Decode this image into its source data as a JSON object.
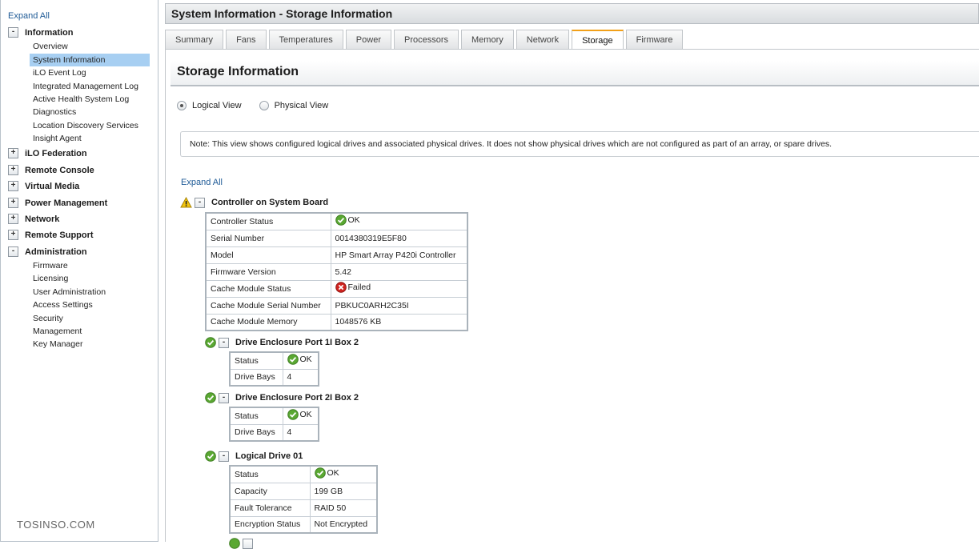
{
  "sidebar": {
    "expand_all": "Expand All",
    "information": {
      "label": "Information",
      "toggle": "-",
      "items": [
        "Overview",
        "System Information",
        "iLO Event Log",
        "Integrated Management Log",
        "Active Health System Log",
        "Diagnostics",
        "Location Discovery Services",
        "Insight Agent"
      ]
    },
    "collapsed": [
      {
        "label": "iLO Federation",
        "toggle": "+"
      },
      {
        "label": "Remote Console",
        "toggle": "+"
      },
      {
        "label": "Virtual Media",
        "toggle": "+"
      },
      {
        "label": "Power Management",
        "toggle": "+"
      },
      {
        "label": "Network",
        "toggle": "+"
      },
      {
        "label": "Remote Support",
        "toggle": "+"
      }
    ],
    "administration": {
      "label": "Administration",
      "toggle": "-",
      "items": [
        "Firmware",
        "Licensing",
        "User Administration",
        "Access Settings",
        "Security",
        "Management",
        "Key Manager"
      ]
    },
    "active_item": "System Information"
  },
  "watermark": "TOSINSO.COM",
  "header": {
    "title": "System Information - Storage Information"
  },
  "tabs": [
    "Summary",
    "Fans",
    "Temperatures",
    "Power",
    "Processors",
    "Memory",
    "Network",
    "Storage",
    "Firmware"
  ],
  "active_tab": "Storage",
  "content": {
    "heading": "Storage Information",
    "view_options": [
      "Logical View",
      "Physical View"
    ],
    "selected_view": "Logical View",
    "note": "Note: This view shows configured logical drives and associated physical drives. It does not show physical drives which are not configured as part of an array, or spare drives.",
    "expand_all": "Expand All",
    "controller": {
      "title": "Controller on System Board",
      "toggle": "-",
      "rows": [
        {
          "label": "Controller Status",
          "value": "OK",
          "icon": "ok-icon"
        },
        {
          "label": "Serial Number",
          "value": "0014380319E5F80"
        },
        {
          "label": "Model",
          "value": "HP Smart Array P420i Controller"
        },
        {
          "label": "Firmware Version",
          "value": "5.42"
        },
        {
          "label": "Cache Module Status",
          "value": "Failed",
          "icon": "failed-icon"
        },
        {
          "label": "Cache Module Serial Number",
          "value": "PBKUC0ARH2C35I"
        },
        {
          "label": "Cache Module Memory",
          "value": "1048576 KB"
        }
      ]
    },
    "enclosures": [
      {
        "title": "Drive Enclosure Port 1I Box 2",
        "toggle": "-",
        "rows": [
          {
            "label": "Status",
            "value": "OK",
            "icon": "ok-icon"
          },
          {
            "label": "Drive Bays",
            "value": "4"
          }
        ]
      },
      {
        "title": "Drive Enclosure Port 2I Box 2",
        "toggle": "-",
        "rows": [
          {
            "label": "Status",
            "value": "OK",
            "icon": "ok-icon"
          },
          {
            "label": "Drive Bays",
            "value": "4"
          }
        ]
      }
    ],
    "logical_drive": {
      "title": "Logical Drive 01",
      "toggle": "-",
      "rows": [
        {
          "label": "Status",
          "value": "OK",
          "icon": "ok-icon"
        },
        {
          "label": "Capacity",
          "value": "199 GB"
        },
        {
          "label": "Fault Tolerance",
          "value": "RAID 50"
        },
        {
          "label": "Encryption Status",
          "value": "Not Encrypted"
        }
      ]
    }
  },
  "colors": {
    "link": "#1e5a96",
    "active_tab_accent": "#f2a019",
    "selected_nav": "#a7cff2",
    "ok_green": "#5aa832",
    "failed_red": "#d0231f",
    "warning_yellow": "#f2c40c"
  }
}
